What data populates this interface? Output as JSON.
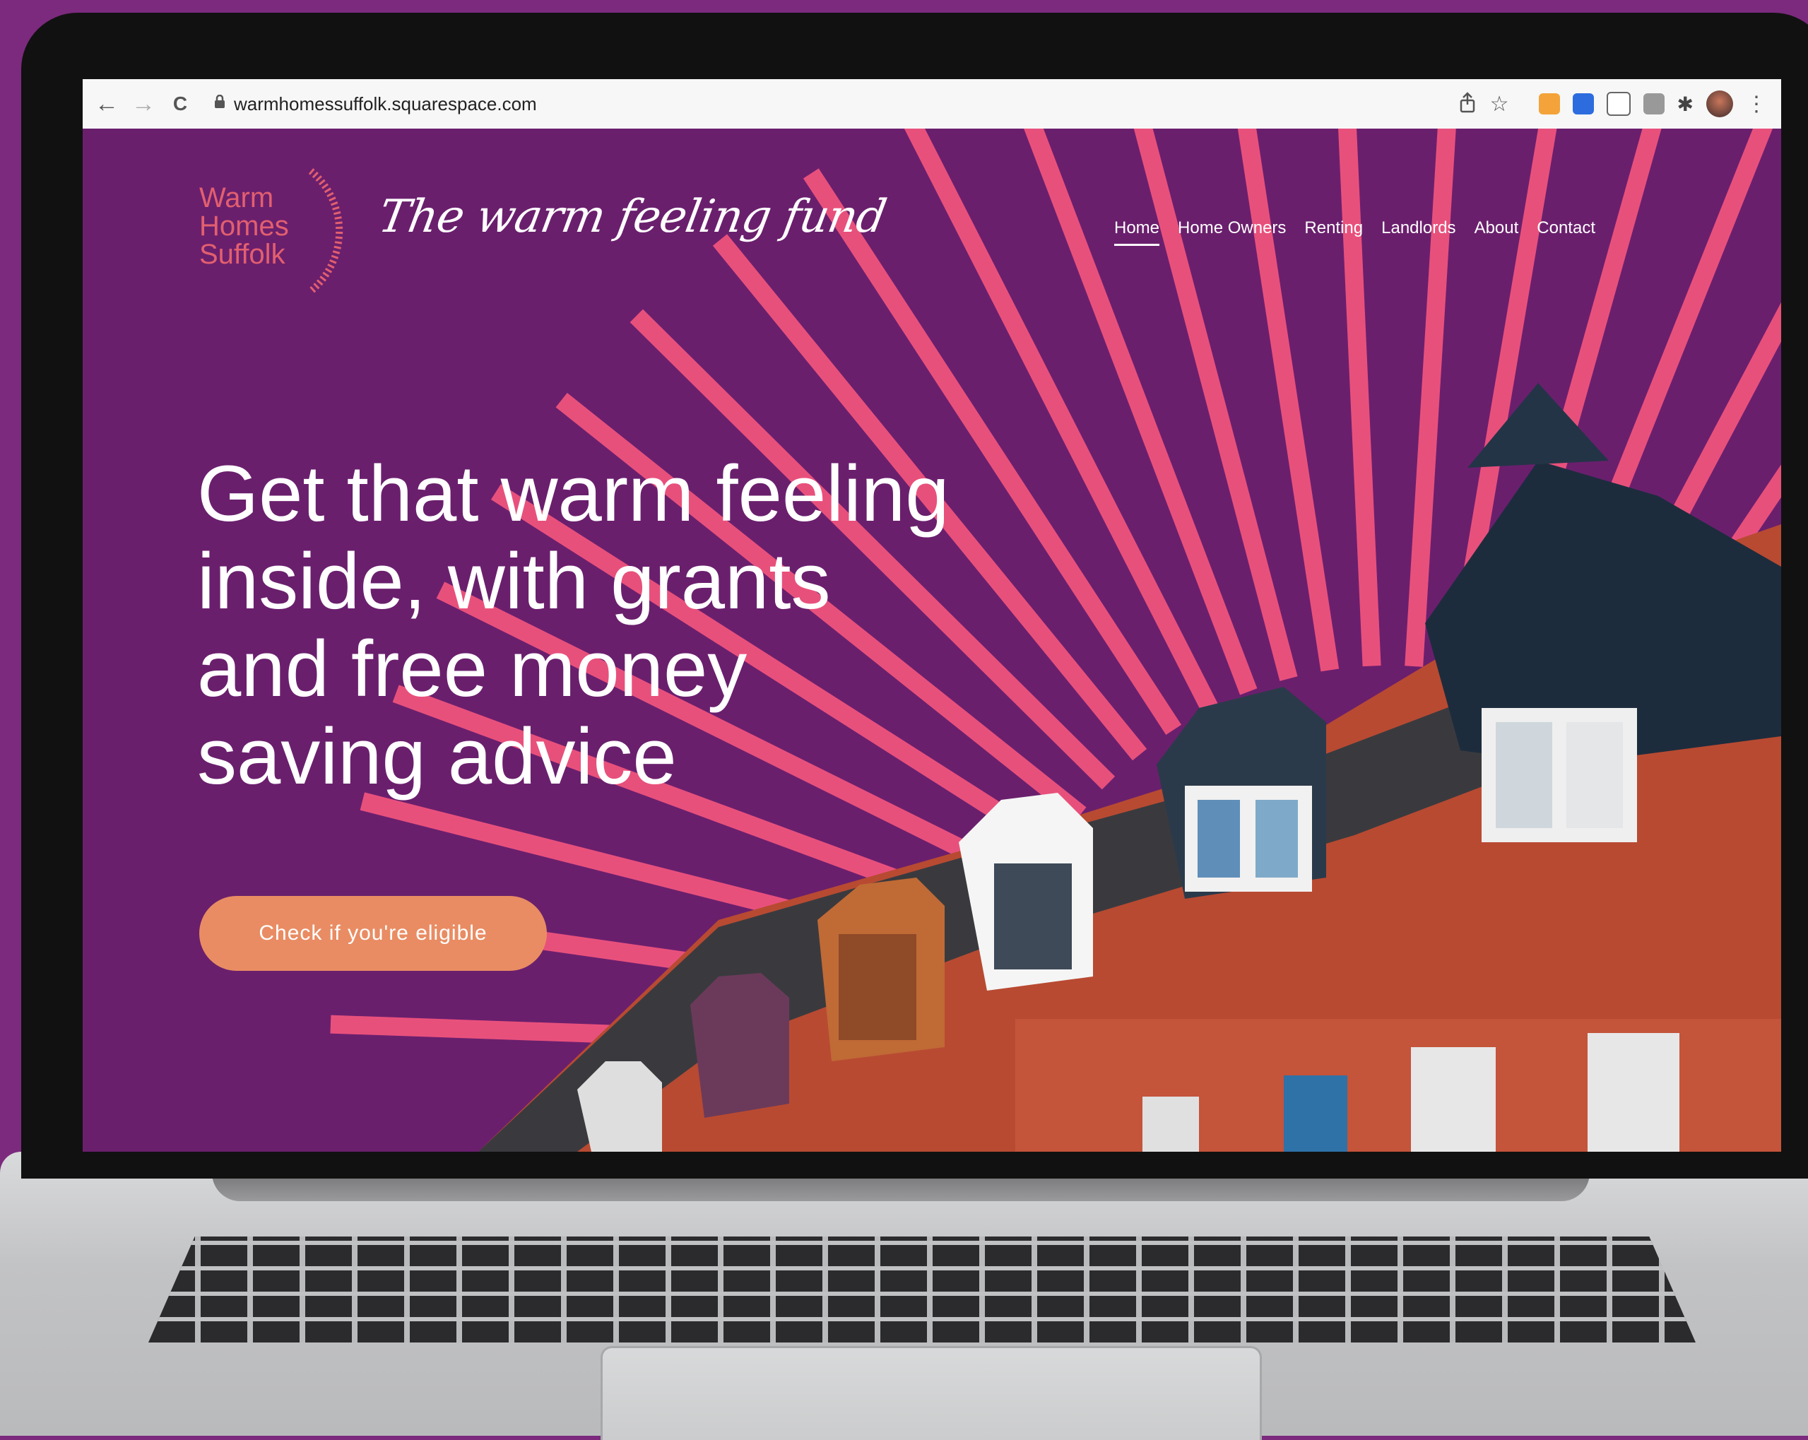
{
  "browser": {
    "back_icon": "←",
    "forward_icon": "→",
    "reload_icon": "C",
    "url": "warmhomessuffolk.squarespace.com",
    "kebab": "⋮"
  },
  "site": {
    "logo_lines": [
      "Warm",
      "Homes",
      "Suffolk"
    ],
    "tagline": "The warm feeling fund",
    "nav": [
      {
        "label": "Home",
        "active": true
      },
      {
        "label": "Home Owners",
        "active": false
      },
      {
        "label": "Renting",
        "active": false
      },
      {
        "label": "Landlords",
        "active": false
      },
      {
        "label": "About",
        "active": false
      },
      {
        "label": "Contact",
        "active": false
      }
    ],
    "headline_lines": [
      "Get that warm feeling",
      "inside, with grants",
      "and free money",
      "saving advice"
    ],
    "cta_label": "Check if you're eligible"
  },
  "colors": {
    "page_bg": "#7b2a7e",
    "site_bg": "#6a1f6d",
    "ray": "#e8507c",
    "cta": "#e98c63",
    "logo": "#e25f6f"
  }
}
